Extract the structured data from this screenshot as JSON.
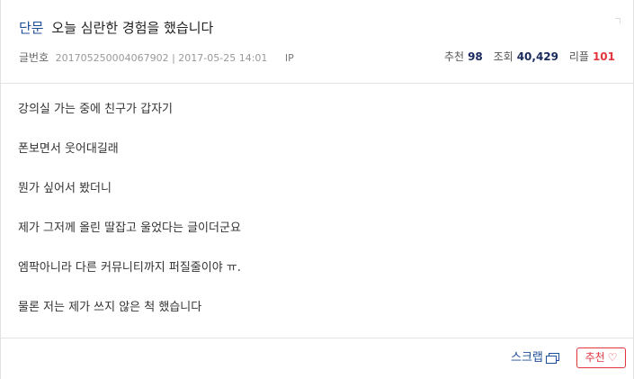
{
  "post": {
    "category": "단문",
    "title": "오늘 심란한 경험을 했습니다",
    "meta": {
      "number_label": "글번호",
      "number_value": "20170525000406790​2 | 2017-05-25 14:01",
      "ip_label": "IP"
    },
    "stats": {
      "recommend_label": "추천",
      "recommend_value": "98",
      "views_label": "조회",
      "views_value": "40,429",
      "replies_label": "리플",
      "replies_value": "101"
    },
    "lines": [
      "강의실 가는 중에 친구가 갑자기",
      "폰보면서 웃어대길래",
      "뭔가 싶어서 봤더니",
      "제가 그저께 올린 딸잡고 울었다는 글이더군요",
      "엠팍아니라 다른 커뮤니티까지 퍼질줄이야 ㅠ.",
      "물론 저는 제가 쓰지 않은 척 했습니다"
    ]
  },
  "footer": {
    "scrap_label": "스크랩",
    "recommend_button_label": "추천",
    "heart_glyph": "♡"
  },
  "colors": {
    "accent_blue": "#1e4e97",
    "accent_red": "#e2363f"
  },
  "icons": {
    "scrap": "scrap-window-icon",
    "heart": "heart-outline-icon"
  }
}
